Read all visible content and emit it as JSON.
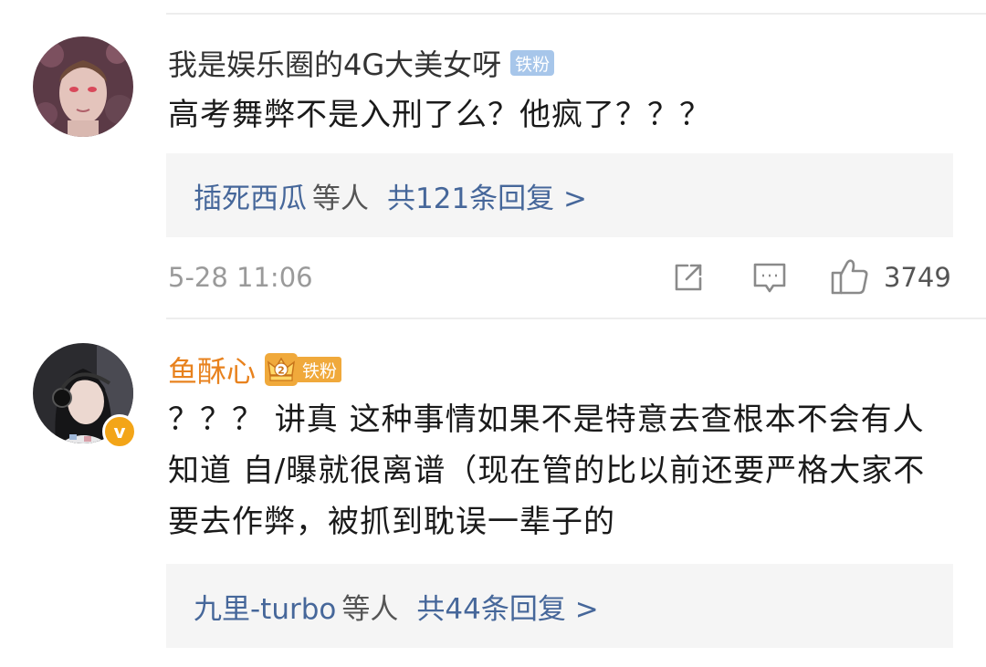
{
  "comments": [
    {
      "username": "我是娱乐圈的4G大美女呀",
      "badge": "铁粉",
      "text": "高考舞弊不是入刑了么？他疯了？？？",
      "reply_names": "插死西瓜",
      "reply_etc": "等人",
      "reply_count": "共121条回复 >",
      "time": "5-28 11:06",
      "likes": "3749",
      "avatar_icon": "user-avatar",
      "accent_color": "#333333"
    },
    {
      "username": "鱼酥心",
      "badge": "铁粉",
      "crown_number": "2",
      "text": "？？？ 讲真 这种事情如果不是特意去查根本不会有人知道 自/曝就很离谱（现在管的比以前还要严格大家不要去作弊，被抓到耽误一辈子的",
      "reply_names": "九里-turbo",
      "reply_etc": "等人",
      "reply_count": "共44条回复 >",
      "verified_mark": "v",
      "accent_color": "#e8821e"
    }
  ],
  "icons": {
    "share": "share-icon",
    "comment": "comment-icon",
    "like": "thumbs-up-icon",
    "crown": "crown-icon"
  },
  "colors": {
    "link": "#46679a",
    "fan_badge_blue": "#a7c6ea",
    "fan_badge_gold": "#f0a93b",
    "verified": "#f3a518"
  }
}
